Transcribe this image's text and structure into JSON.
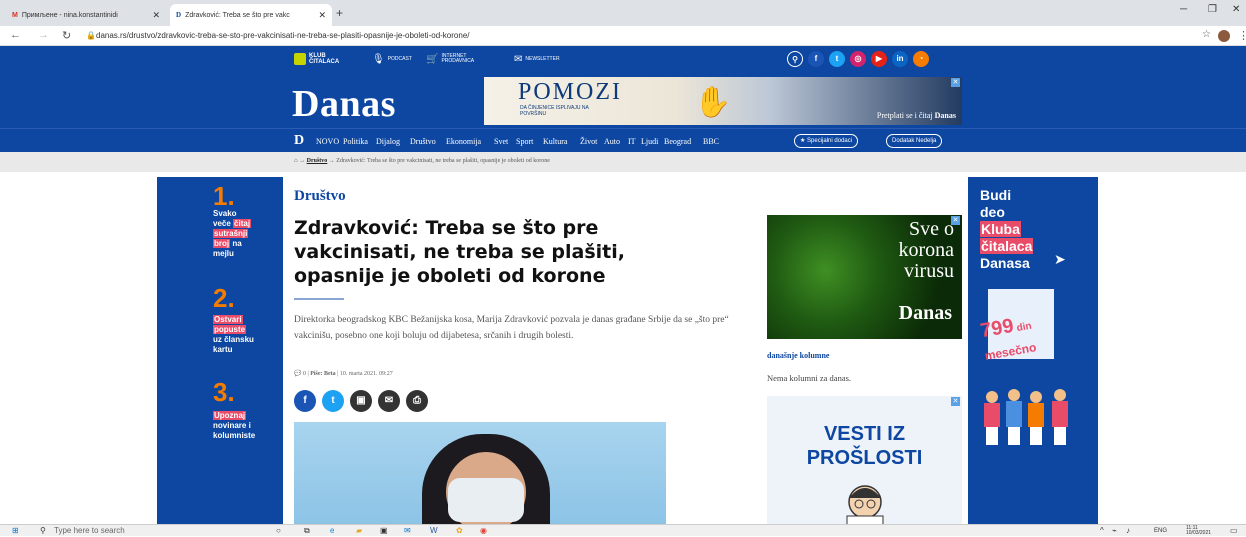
{
  "browser": {
    "tabs": [
      {
        "label": "Примљене - nina.konstantinidi"
      },
      {
        "label": "Zdravković: Treba se što pre vakc"
      }
    ],
    "url": "danas.rs/drustvo/zdravkovic-treba-se-sto-pre-vakcinisati-ne-treba-se-plasiti-opasnije-je-oboleti-od-korone/"
  },
  "topbar": {
    "klub": "KLUB ČITALACA",
    "podcast": "PODCAST",
    "prodavnica": "INTERNET PRODAVNICA",
    "newsletter": "NEWSLETTER",
    "social": [
      "q",
      "f",
      "t",
      "ig",
      "yt",
      "in",
      "rss"
    ]
  },
  "header": {
    "logo": "Danas",
    "ad": {
      "title": "POMOZI",
      "subtitle": "DA ČINJENICE ISPLIVAJU NA POVRŠINU",
      "cta_prefix": "Pretplati se i čitaj ",
      "cta_brand": "Danas"
    }
  },
  "nav": {
    "items": [
      "NOVO",
      "Politika",
      "Dijalog",
      "Društvo",
      "Ekonomija",
      "Svet",
      "Sport",
      "Kultura",
      "Život",
      "Auto",
      "IT",
      "Ljudi",
      "Beograd",
      "BBC"
    ],
    "special": "Specijalni dodaci",
    "sunday": "Dodatak Nedelja"
  },
  "breadcrumb": {
    "section": "Društvo",
    "current": "Zdravković: Treba se što pre vakcinisati, ne treba se plašiti, opasnije je oboleti od korone"
  },
  "article": {
    "section": "Društvo",
    "title": "Zdravković: Treba se što pre vakcinisati, ne treba se plašiti, opasnije je oboleti od korone",
    "lead": "Direktorka beogradskog KBC Bežanijska kosa, Marija Zdravković pozvala je danas građane Srbije da se „što pre“ vakcinišu, posebno one koji boluju od dijabetesa, srčanih i drugih bolesti.",
    "comments": "0",
    "author": "Piše: Beta",
    "date": "10. marta 2021. 09:27"
  },
  "leftad": {
    "n1": "1.",
    "t1a": "Svako",
    "t1b": "veče",
    "t1c": "čitaj",
    "t1d": "sutrašnji",
    "t1e": "broj",
    "t1f": "na",
    "t1g": "mejlu",
    "n2": "2.",
    "t2a": "Ostvari",
    "t2b": "popuste",
    "t2c": "uz člansku",
    "t2d": "kartu",
    "n3": "3.",
    "t3a": "Upoznaj",
    "t3b": "novinare i",
    "t3c": "kolumniste"
  },
  "rightad": {
    "l1": "Budi",
    "l2": "deo",
    "l3": "Kluba",
    "l4": "čitalaca",
    "l5": "Danasa",
    "price": "799",
    "unit": "din",
    "period": "mesečno"
  },
  "sidebar": {
    "covid_l1": "Sve o",
    "covid_l2": "korona",
    "covid_l3": "virusu",
    "covid_brand": "Danas",
    "kol_heading": "današnje kolumne",
    "kol_empty": "Nema kolumni za danas.",
    "vesti_l1": "VESTI IZ",
    "vesti_l2": "PROŠLOSTI"
  },
  "taskbar": {
    "search": "Type here to search",
    "lang": "ENG",
    "time": "11:11",
    "date": "10/03/2021"
  }
}
